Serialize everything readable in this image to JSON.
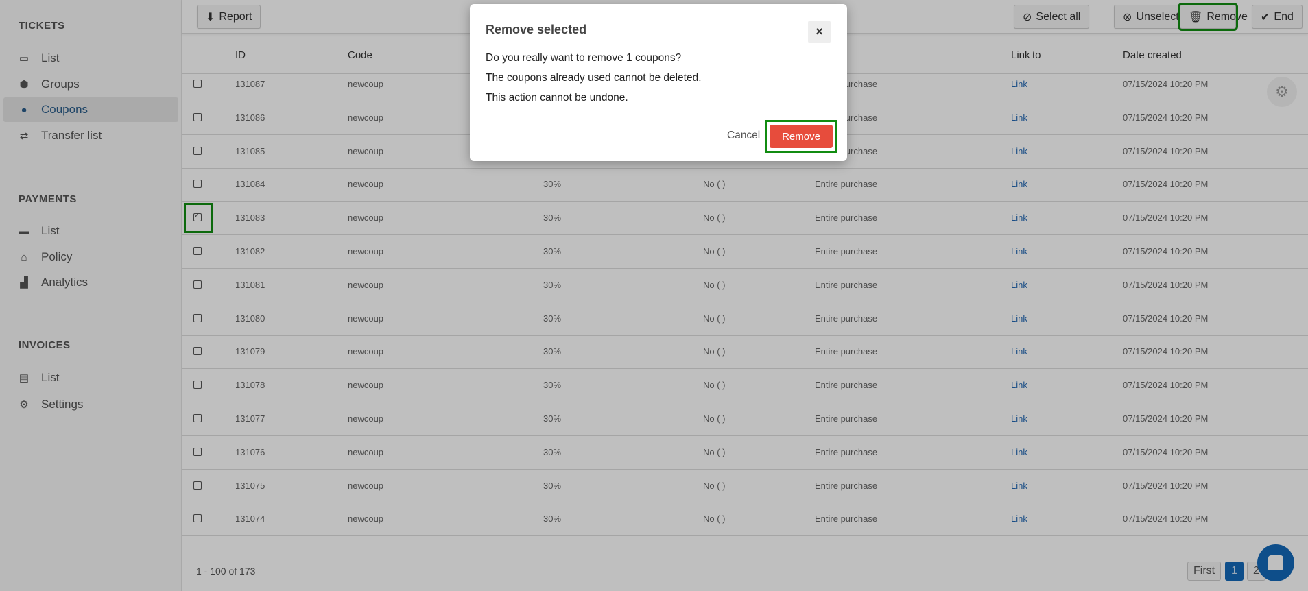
{
  "sidebar": {
    "tickets_header": "TICKETS",
    "tickets": [
      {
        "label": "List",
        "icon": "list-icon"
      },
      {
        "label": "Groups",
        "icon": "groups-icon"
      },
      {
        "label": "Coupons",
        "icon": "coupon-icon"
      },
      {
        "label": "Transfer list",
        "icon": "transfer-icon"
      }
    ],
    "payments_header": "PAYMENTS",
    "payments": [
      {
        "label": "List",
        "icon": "card-icon"
      },
      {
        "label": "Policy",
        "icon": "bank-icon"
      },
      {
        "label": "Analytics",
        "icon": "chart-icon"
      }
    ],
    "invoices_header": "INVOICES",
    "invoices": [
      {
        "label": "List",
        "icon": "invoice-icon"
      },
      {
        "label": "Settings",
        "icon": "gear-icon"
      }
    ]
  },
  "toolbar": {
    "report": "Report",
    "select_all": "Select all",
    "unselect_all": "Unselect all",
    "remove": "Remove",
    "end": "End"
  },
  "table": {
    "headers": {
      "id": "ID",
      "code": "Code",
      "applies": "to",
      "link": "Link",
      "date": "Date created"
    },
    "rows": [
      {
        "id": "131087",
        "code": "newcoup",
        "discount": "30%",
        "used": "No ( )",
        "applies": "Entire purchase",
        "link": "Link",
        "date": "07/15/2024 10:20 PM",
        "checked": false
      },
      {
        "id": "131086",
        "code": "newcoup",
        "discount": "30%",
        "used": "No ( )",
        "applies": "Entire purchase",
        "link": "Link",
        "date": "07/15/2024 10:20 PM",
        "checked": false
      },
      {
        "id": "131085",
        "code": "newcoup",
        "discount": "30%",
        "used": "No ( )",
        "applies": "Entire purchase",
        "link": "Link",
        "date": "07/15/2024 10:20 PM",
        "checked": false
      },
      {
        "id": "131084",
        "code": "newcoup",
        "discount": "30%",
        "used": "No ( )",
        "applies": "Entire purchase",
        "link": "Link",
        "date": "07/15/2024 10:20 PM",
        "checked": false
      },
      {
        "id": "131083",
        "code": "newcoup",
        "discount": "30%",
        "used": "No ( )",
        "applies": "Entire purchase",
        "link": "Link",
        "date": "07/15/2024 10:20 PM",
        "checked": true
      },
      {
        "id": "131082",
        "code": "newcoup",
        "discount": "30%",
        "used": "No ( )",
        "applies": "Entire purchase",
        "link": "Link",
        "date": "07/15/2024 10:20 PM",
        "checked": false
      },
      {
        "id": "131081",
        "code": "newcoup",
        "discount": "30%",
        "used": "No ( )",
        "applies": "Entire purchase",
        "link": "Link",
        "date": "07/15/2024 10:20 PM",
        "checked": false
      },
      {
        "id": "131080",
        "code": "newcoup",
        "discount": "30%",
        "used": "No ( )",
        "applies": "Entire purchase",
        "link": "Link",
        "date": "07/15/2024 10:20 PM",
        "checked": false
      },
      {
        "id": "131079",
        "code": "newcoup",
        "discount": "30%",
        "used": "No ( )",
        "applies": "Entire purchase",
        "link": "Link",
        "date": "07/15/2024 10:20 PM",
        "checked": false
      },
      {
        "id": "131078",
        "code": "newcoup",
        "discount": "30%",
        "used": "No ( )",
        "applies": "Entire purchase",
        "link": "Link",
        "date": "07/15/2024 10:20 PM",
        "checked": false
      },
      {
        "id": "131077",
        "code": "newcoup",
        "discount": "30%",
        "used": "No ( )",
        "applies": "Entire purchase",
        "link": "Link",
        "date": "07/15/2024 10:20 PM",
        "checked": false
      },
      {
        "id": "131076",
        "code": "newcoup",
        "discount": "30%",
        "used": "No ( )",
        "applies": "Entire purchase",
        "link": "Link",
        "date": "07/15/2024 10:20 PM",
        "checked": false
      },
      {
        "id": "131075",
        "code": "newcoup",
        "discount": "30%",
        "used": "No ( )",
        "applies": "Entire purchase",
        "link": "Link",
        "date": "07/15/2024 10:20 PM",
        "checked": false
      },
      {
        "id": "131074",
        "code": "newcoup",
        "discount": "30%",
        "used": "No ( )",
        "applies": "Entire purchase",
        "link": "Link",
        "date": "07/15/2024 10:20 PM",
        "checked": false
      }
    ]
  },
  "footer": {
    "range": "1 - 100 of 173",
    "pages": {
      "first": "First",
      "p1": "1",
      "p2": "2"
    }
  },
  "modal": {
    "title": "Remove selected",
    "close": "×",
    "line1": "Do you really want to remove 1 coupons?",
    "line2": "The coupons already used cannot be deleted.",
    "line3": "This action cannot be undone.",
    "cancel": "Cancel",
    "remove": "Remove"
  },
  "colors": {
    "accent": "#1369b8",
    "danger": "#e74c3c",
    "highlight": "#118c11"
  }
}
